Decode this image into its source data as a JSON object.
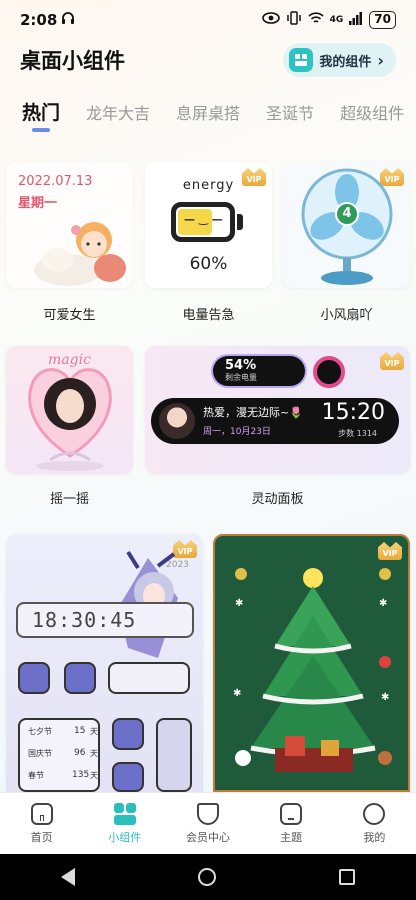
{
  "status": {
    "time": "2:08",
    "network": "4G",
    "battery": "70"
  },
  "header": {
    "title": "桌面小组件",
    "my_widgets_label": "我的组件",
    "my_widgets_chevron": "›"
  },
  "tabs": [
    "热门",
    "龙年大吉",
    "息屏桌搭",
    "圣诞节",
    "超级组件"
  ],
  "row1": [
    {
      "label": "可爱女生",
      "date": "2022.07.13",
      "weekday": "星期一",
      "vip": false
    },
    {
      "label": "电量告急",
      "title": "energy",
      "percent": "60%",
      "vip": true
    },
    {
      "label": "小风扇吖",
      "fan_number": "4",
      "vip": true
    }
  ],
  "row2": [
    {
      "label": "摇一摇",
      "vip": false,
      "frame_text": "magic"
    },
    {
      "label": "灵动面板",
      "vip": true,
      "battery_pct": "54%",
      "battery_sub": "剩余电量",
      "message": "热爱，漫无边际~🌷",
      "date_line": "周一，10月23日",
      "time": "15:20",
      "steps": "步数 1314"
    }
  ],
  "row3": [
    {
      "time": "18:30:45",
      "year": "2023",
      "vip": true,
      "countdowns": [
        {
          "name": "七夕节",
          "days": "15"
        },
        {
          "name": "国庆节",
          "days": "96"
        },
        {
          "name": "春节",
          "days": "135"
        }
      ],
      "day_unit": "天"
    },
    {
      "vip": true
    }
  ],
  "vip_label": "VIP",
  "nav": [
    {
      "label": "首页",
      "active": false
    },
    {
      "label": "小组件",
      "active": true
    },
    {
      "label": "会员中心",
      "active": false
    },
    {
      "label": "主题",
      "active": false
    },
    {
      "label": "我的",
      "active": false
    }
  ],
  "colors": {
    "accent": "#2bbfbc",
    "tab_indicator": "#6b8ce8",
    "date_pink": "#e0576e"
  }
}
